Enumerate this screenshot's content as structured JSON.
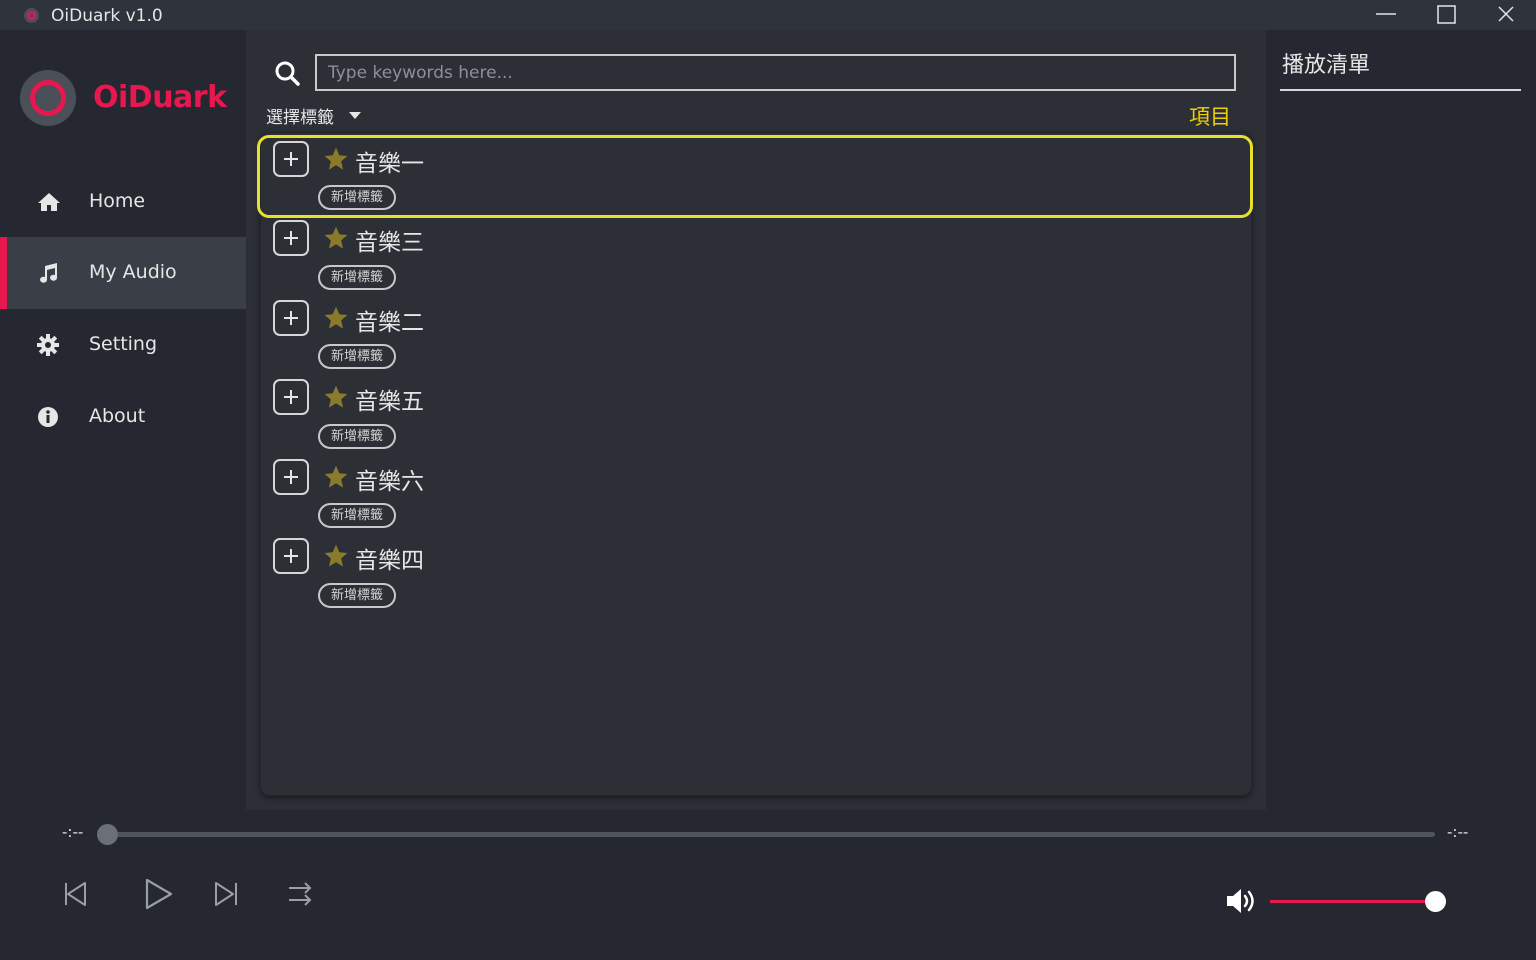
{
  "window": {
    "title": "OiDuark v1.0",
    "icons": [
      "app-logo-icon",
      "minimize-icon",
      "maximize-icon",
      "close-icon"
    ]
  },
  "sidebar": {
    "brand": "OiDuark",
    "items": [
      {
        "label": "Home",
        "icon": "home-icon",
        "active": false
      },
      {
        "label": "My Audio",
        "icon": "music-note-icon",
        "active": true
      },
      {
        "label": "Setting",
        "icon": "gear-icon",
        "active": false
      },
      {
        "label": "About",
        "icon": "info-icon",
        "active": false
      }
    ]
  },
  "main": {
    "search": {
      "placeholder": "Type keywords here...",
      "value": "",
      "icon": "search-icon"
    },
    "tag_select": {
      "label": "選擇標籤"
    },
    "items_label": "項目",
    "songs": [
      {
        "title": "音樂一",
        "tag_button": "新增標籤",
        "highlighted": true
      },
      {
        "title": "音樂三",
        "tag_button": "新增標籤",
        "highlighted": false
      },
      {
        "title": "音樂二",
        "tag_button": "新增標籤",
        "highlighted": false
      },
      {
        "title": "音樂五",
        "tag_button": "新增標籤",
        "highlighted": false
      },
      {
        "title": "音樂六",
        "tag_button": "新增標籤",
        "highlighted": false
      },
      {
        "title": "音樂四",
        "tag_button": "新增標籤",
        "highlighted": false
      }
    ]
  },
  "playlist": {
    "title": "播放清單"
  },
  "player": {
    "elapsed": "-:--",
    "total": "-:--",
    "progress": 0,
    "volume": 1.0,
    "controls": [
      "skip-back-icon",
      "play-icon",
      "skip-forward-icon",
      "shuffle-icon"
    ]
  },
  "colors": {
    "accent": "#e8174f",
    "highlight": "#e7e02c",
    "items_label": "#f0d000",
    "star": "#8a7a2c",
    "background": "#252830",
    "panel": "#2c2f36"
  }
}
